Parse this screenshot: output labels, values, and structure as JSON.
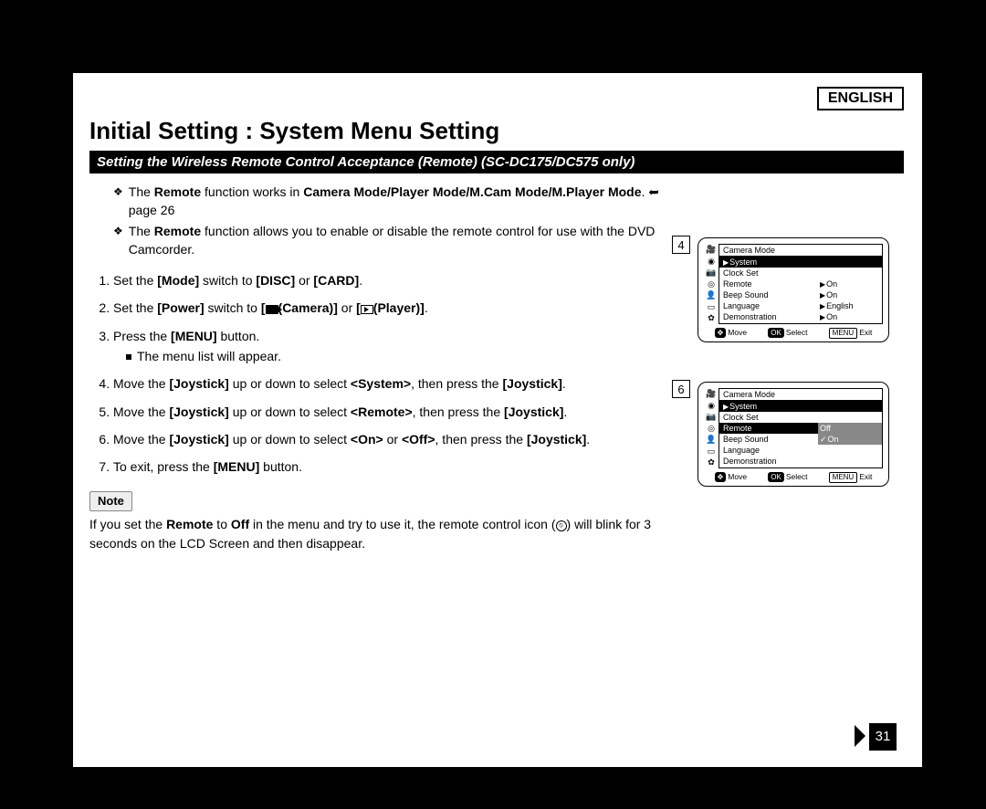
{
  "language_label": "ENGLISH",
  "title": "Initial Setting : System Menu Setting",
  "subtitle": "Setting the Wireless Remote Control Acceptance (Remote) (SC-DC175/DC575 only)",
  "bullets": {
    "b1_pre": "The ",
    "b1_bold1": "Remote",
    "b1_mid1": " function works in ",
    "b1_bold2": "Camera Mode/Player Mode/M.Cam Mode/M.Player Mode",
    "b1_post": ". ",
    "b1_pageref": "page 26",
    "b2_pre": "The ",
    "b2_bold": "Remote",
    "b2_post": " function allows you to enable or disable the remote control for use with the DVD Camcorder."
  },
  "steps": {
    "s1_pre": "Set the ",
    "s1_b1": "[Mode]",
    "s1_mid": " switch to ",
    "s1_b2": "[DISC]",
    "s1_or": " or ",
    "s1_b3": "[CARD]",
    "s1_post": ".",
    "s2_pre": "Set the ",
    "s2_b1": "[Power]",
    "s2_mid": " switch to ",
    "s2_b2a": "[",
    "s2_cam": "(Camera)]",
    "s2_or": " or ",
    "s2_b3a": "[",
    "s2_play": "(Player)]",
    "s2_post": ".",
    "s3_pre": "Press the ",
    "s3_b": "[MENU]",
    "s3_post": " button.",
    "s3_sub": "The menu list will appear.",
    "s4_pre": "Move the ",
    "s4_b1": "[Joystick]",
    "s4_mid1": " up or down to select ",
    "s4_b2": "<System>",
    "s4_mid2": ", then press the ",
    "s4_b3": "[Joystick]",
    "s4_post": ".",
    "s5_pre": "Move the ",
    "s5_b1": "[Joystick]",
    "s5_mid1": " up or down to select ",
    "s5_b2": "<Remote>",
    "s5_mid2": ", then press the ",
    "s5_b3": "[Joystick]",
    "s5_post": ".",
    "s6_pre": "Move the ",
    "s6_b1": "[Joystick]",
    "s6_mid1": " up or down to select ",
    "s6_b2": "<On>",
    "s6_or": " or ",
    "s6_b3": "<Off>",
    "s6_mid2": ", then press the ",
    "s6_b4": "[Joystick]",
    "s6_post": ".",
    "s7_pre": "To exit, press the ",
    "s7_b": "[MENU]",
    "s7_post": " button."
  },
  "note_label": "Note",
  "note": {
    "pre": "If you set the ",
    "b1": "Remote",
    "mid1": " to ",
    "b2": "Off",
    "mid2": " in the menu and try to use it, the remote control icon (",
    "mid3": ") will blink for 3 seconds on the LCD Screen and then disappear."
  },
  "screens": {
    "step4_num": "4",
    "step6_num": "6",
    "header": "Camera Mode",
    "system": "System",
    "items": {
      "clock": "Clock Set",
      "remote": "Remote",
      "beep": "Beep Sound",
      "lang": "Language",
      "demo": "Demonstration"
    },
    "vals4": {
      "remote": "On",
      "beep": "On",
      "lang": "English",
      "demo": "On"
    },
    "vals6": {
      "remote_off": "Off",
      "remote_on": "On"
    },
    "footer": {
      "move": "Move",
      "select": "Select",
      "exit": "Exit",
      "ok": "OK",
      "menu": "MENU"
    }
  },
  "page_number": "31"
}
